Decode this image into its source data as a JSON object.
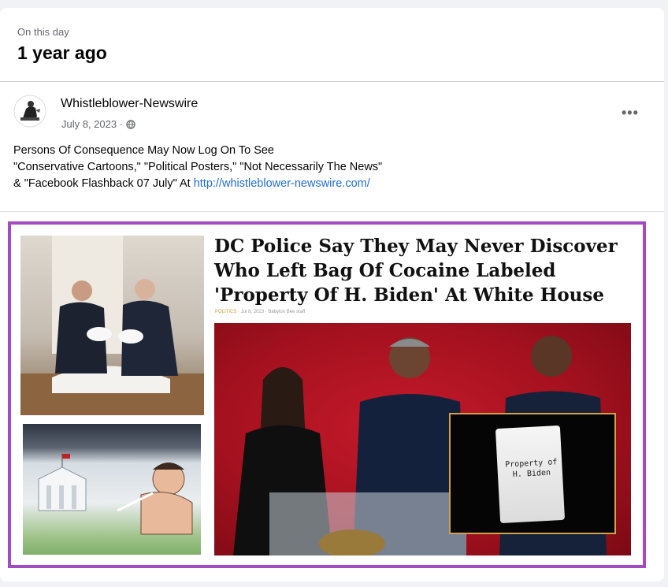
{
  "memory": {
    "label": "On this day",
    "title": "1 year ago"
  },
  "post": {
    "author": "Whistleblower-Newswire",
    "date": "July 8, 2023",
    "audience_icon": "globe-icon",
    "more_label": "•••",
    "text_lines": [
      "Persons Of Consequence May Now Log On To See",
      "\"Conservative Cartoons,\" \"Political Posters,\" \"Not Necessarily The News\"",
      "& \"Facebook Flashback 07 July\" At "
    ],
    "link_text": "http://whistleblower-newswire.com/"
  },
  "image": {
    "headline": "DC Police Say They May Never Discover Who Left Bag Of Cocaine Labeled 'Property Of H. Biden' At White House",
    "byline_tag": "POLITICS",
    "byline_rest": "· Jul 8, 2023 · Babylon Bee staff",
    "bag_label": "Property of H. Biden",
    "frame_color": "#a34bc2"
  }
}
